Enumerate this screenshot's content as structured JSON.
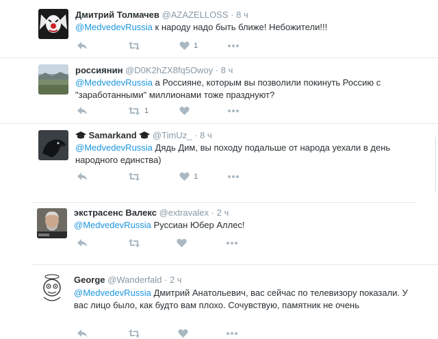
{
  "tweets": [
    {
      "name": "Дмитрий Толмачев",
      "handle": "@AZAZELLOSS",
      "time": "8 ч",
      "mention": "@MedvedevRussia",
      "text": "к народу надо быть ближе! Небожители!!!",
      "likes": "1",
      "retweets": ""
    },
    {
      "name": "россиянин",
      "handle": "@D0K2hZX8fq5Owoy",
      "time": "8 ч",
      "mention": "@MedvedevRussia",
      "text": "а Россияне, которым вы позволили покинуть Россию с \"заработанными\" миллионами тоже празднуют?",
      "likes": "",
      "retweets": "1"
    },
    {
      "name": "Samarkand",
      "handle": "@TimUz_",
      "time": "8 ч",
      "mention": "@MedvedevRussia",
      "text": "Дядь Дим, вы походу подальше от народа уехали в день народного единства)",
      "likes": "1",
      "retweets": ""
    },
    {
      "name": "экстрасенс Валекс",
      "handle": "@extravalex",
      "time": "2 ч",
      "mention": "@MedvedevRussia",
      "text": "Руссиан Юбер Аллес!",
      "likes": "",
      "retweets": ""
    },
    {
      "name": "George",
      "handle": "@Wanderfald",
      "time": "2 ч",
      "mention": "@MedvedevRussia",
      "text": "Дмитрий Анатольевич, вас сейчас по телевизору показали. У вас лицо было,  как будто вам плохо. Сочувствую, памятник не очень",
      "likes": "",
      "retweets": ""
    }
  ],
  "separator": "·",
  "icons": {
    "reply": "reply-icon",
    "retweet": "retweet-icon",
    "like": "heart-icon",
    "more": "more-icon",
    "badge": "graduation-cap-icon"
  },
  "colors": {
    "mention": "#1b95e0",
    "meta": "#8899a6",
    "icon": "#aab8c2",
    "text": "#292f33"
  }
}
